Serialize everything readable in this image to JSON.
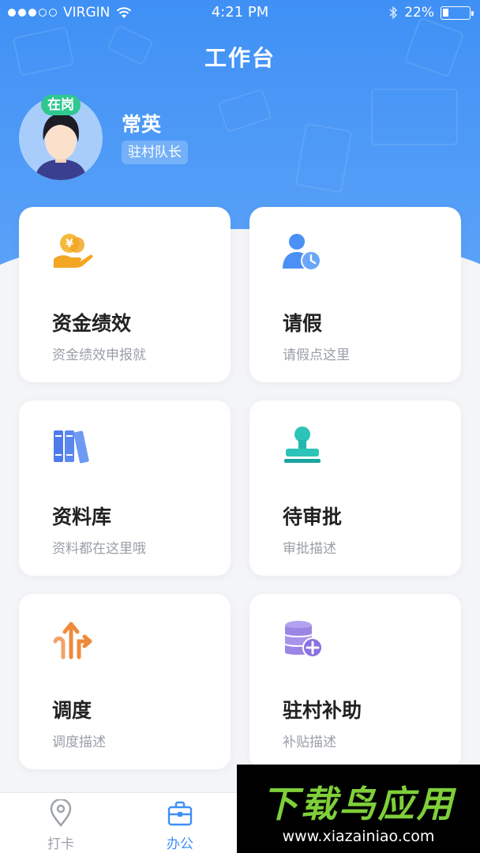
{
  "status_bar": {
    "carrier": "VIRGIN",
    "time": "4:21 PM",
    "battery_percent": "22%",
    "signal_bars": 3
  },
  "header": {
    "title": "工作台"
  },
  "user": {
    "status_badge": "在岗",
    "name": "常英",
    "role": "驻村队长"
  },
  "cards": [
    {
      "title": "资金绩效",
      "desc": "资金绩效申报就",
      "icon": "coin-hand-icon",
      "color": "#f2a623"
    },
    {
      "title": "请假",
      "desc": "请假点这里",
      "icon": "user-clock-icon",
      "color": "#4a90f5"
    },
    {
      "title": "资料库",
      "desc": "资料都在这里哦",
      "icon": "books-icon",
      "color": "#4e7bea"
    },
    {
      "title": "待审批",
      "desc": "审批描述",
      "icon": "stamp-icon",
      "color": "#22b8b0"
    },
    {
      "title": "调度",
      "desc": "调度描述",
      "icon": "dispatch-arrows-icon",
      "color": "#ee8a3c"
    },
    {
      "title": "驻村补助",
      "desc": "补贴描述",
      "icon": "coin-stack-plus-icon",
      "color": "#9b86e6"
    }
  ],
  "tabbar": {
    "items": [
      {
        "label": "打卡",
        "icon": "location-pin-icon",
        "active": false
      },
      {
        "label": "办公",
        "icon": "briefcase-icon",
        "active": true
      }
    ]
  },
  "watermark": {
    "logo_text": "下载鸟应用",
    "url": "www.xiazainiao.com"
  },
  "colors": {
    "header_blue": "#3f90f5",
    "active_tab": "#3f8ff5",
    "on_duty_badge": "#2fc88e"
  }
}
